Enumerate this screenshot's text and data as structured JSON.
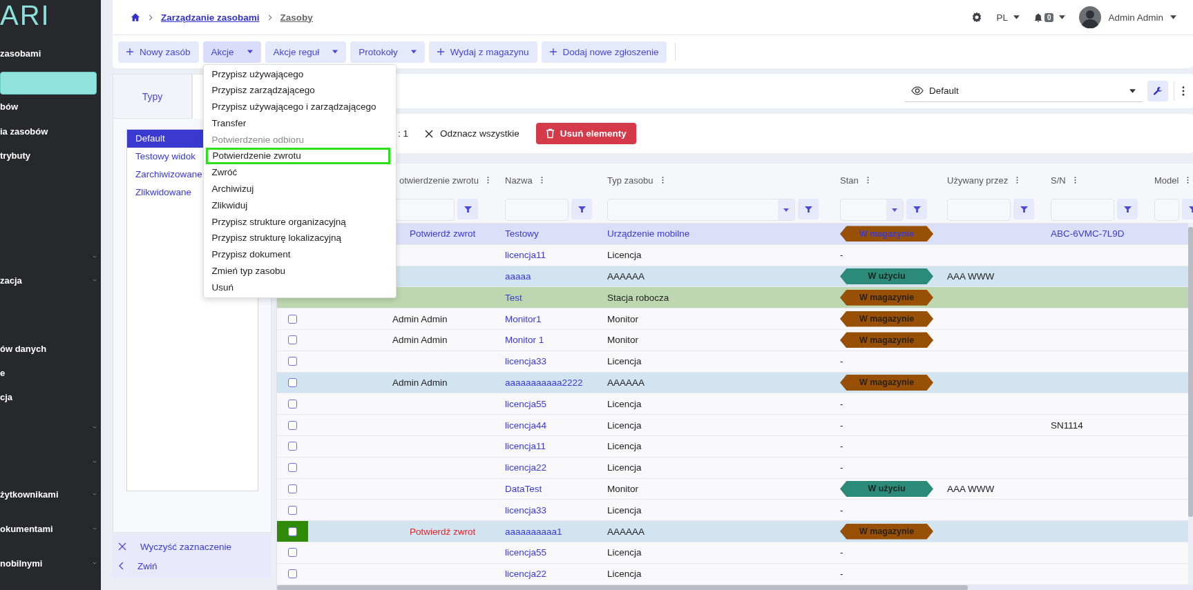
{
  "sidebar": {
    "logo": "ARI",
    "items": [
      {
        "label": "zasobami",
        "selected": false,
        "expandable": false
      },
      {
        "selected": true,
        "expandable": false
      },
      {
        "label": "bów",
        "selected": false,
        "expandable": false
      },
      {
        "label": "ia zasobów",
        "selected": false,
        "expandable": false
      },
      {
        "label": "trybuty",
        "selected": false,
        "expandable": false
      },
      {
        "selected": false,
        "expandable": true
      },
      {
        "label": "zacja",
        "selected": false,
        "expandable": true
      },
      {
        "label": "ów danych",
        "selected": false,
        "expandable": false
      },
      {
        "label": "e",
        "selected": false,
        "expandable": false
      },
      {
        "label": "cja",
        "selected": false,
        "expandable": false
      },
      {
        "selected": false,
        "expandable": true
      },
      {
        "selected": false,
        "expandable": true
      },
      {
        "label": "żytkownikami",
        "selected": false,
        "expandable": true
      },
      {
        "label": "okumentami",
        "selected": false,
        "expandable": true
      },
      {
        "label": "nobilnymi",
        "selected": false,
        "expandable": true
      }
    ]
  },
  "header": {
    "breadcrumb": [
      {
        "label": "Zarządzanie zasobami",
        "current": false
      },
      {
        "label": "Zasoby",
        "current": true
      }
    ],
    "language": "PL",
    "notifications": "0",
    "user": "Admin Admin"
  },
  "toolbar": {
    "buttons": [
      {
        "label": "Nowy zasób",
        "kind": "add",
        "expanded": false
      },
      {
        "label": "Akcje",
        "kind": "dropdown",
        "expanded": true
      },
      {
        "label": "Akcje reguł",
        "kind": "dropdown",
        "expanded": false
      },
      {
        "label": "Protokoły",
        "kind": "dropdown",
        "expanded": false
      },
      {
        "label": "Wydaj z magazynu",
        "kind": "add",
        "expanded": false
      },
      {
        "label": "Dodaj nowe zgłoszenie",
        "kind": "add",
        "expanded": false
      }
    ]
  },
  "actions_menu": {
    "items": [
      {
        "label": "Przypisz używającego",
        "disabled": false,
        "focused": false
      },
      {
        "label": "Przypisz zarządzającego",
        "disabled": false,
        "focused": false
      },
      {
        "label": "Przypisz używającego i zarządzającego",
        "disabled": false,
        "focused": false
      },
      {
        "label": "Transfer",
        "disabled": false,
        "focused": false
      },
      {
        "label": "Potwierdzenie odbioru",
        "disabled": true,
        "focused": false
      },
      {
        "label": "Potwierdzenie zwrotu",
        "disabled": false,
        "focused": true
      },
      {
        "label": "Zwróć",
        "disabled": false,
        "focused": false
      },
      {
        "label": "Archiwizuj",
        "disabled": false,
        "focused": false
      },
      {
        "label": "Zlikwiduj",
        "disabled": false,
        "focused": false
      },
      {
        "label": "Przypisz strukture organizacyjną",
        "disabled": false,
        "focused": false
      },
      {
        "label": "Przypisz strukturę lokalizacyjną",
        "disabled": false,
        "focused": false
      },
      {
        "label": "Przypisz dokument",
        "disabled": false,
        "focused": false
      },
      {
        "label": "Zmień typ zasobu",
        "disabled": false,
        "focused": false
      },
      {
        "label": "Usuń",
        "disabled": false,
        "focused": false
      }
    ]
  },
  "views_panel": {
    "tabs": [
      {
        "label": "Typy",
        "selected": false
      },
      {
        "selected": true
      }
    ],
    "views": [
      {
        "label": "Default",
        "selected": true
      },
      {
        "label": "Testowy widok",
        "selected": false
      },
      {
        "label": "Zarchiwizowane",
        "selected": false
      },
      {
        "label": "Zlikwidowane",
        "selected": false
      }
    ],
    "footer_actions": [
      {
        "label": "Wyczyść zaznaczenie",
        "kind": "clear"
      },
      {
        "label": "Zwiń",
        "kind": "collapse"
      }
    ]
  },
  "view_selector": {
    "value": "Default"
  },
  "selection_bar": {
    "count_text": ": 1",
    "clear_label": "Odznacz wszystkie",
    "delete_label": "Usuń elementy"
  },
  "table": {
    "columns": [
      {
        "label": "otwierdzenie zwrotu",
        "kind": "text"
      },
      {
        "label": "Nazwa",
        "kind": "text"
      },
      {
        "label": "Typ zasobu",
        "kind": "select"
      },
      {
        "label": "Stan",
        "kind": "select"
      },
      {
        "label": "Używany przez",
        "kind": "text"
      },
      {
        "label": "S/N",
        "kind": "text"
      },
      {
        "label": "Model",
        "kind": "text"
      }
    ],
    "rows": [
      {
        "selected": true,
        "return_action": {
          "label": "Potwierdź zwrot",
          "urgent": false
        },
        "name": "Testowy",
        "type": "Urządzenie mobilne",
        "status": {
          "label": "W magazynie",
          "kind": "in_stock"
        },
        "serial": "ABC-6VMC-7L9D"
      },
      {
        "selected": false,
        "name": "licencja11",
        "type": "Licencja",
        "status": {
          "label": "-",
          "kind": "none"
        }
      },
      {
        "selected": false,
        "color": "#d1e4ef",
        "name": "aaaaa",
        "type": "AAAAAA",
        "status": {
          "label": "W użyciu",
          "kind": "in_use"
        },
        "used_by": "AAA WWW"
      },
      {
        "selected": false,
        "color": "#bdd8b0",
        "name": "Test",
        "type": "Stacja robocza",
        "status": {
          "label": "W magazynie",
          "kind": "in_stock"
        }
      },
      {
        "selected": false,
        "checked": false,
        "flagged": false,
        "person": "Admin Admin",
        "name": "Monitor1",
        "type": "Monitor",
        "status": {
          "label": "W magazynie",
          "kind": "in_stock"
        }
      },
      {
        "selected": false,
        "checked": false,
        "flagged": false,
        "person": "Admin Admin",
        "name": "Monitor 1",
        "type": "Monitor",
        "status": {
          "label": "W magazynie",
          "kind": "in_stock"
        }
      },
      {
        "selected": false,
        "checked": false,
        "flagged": false,
        "name": "licencja33",
        "type": "Licencja",
        "status": {
          "label": "-",
          "kind": "none"
        }
      },
      {
        "selected": false,
        "checked": false,
        "flagged": false,
        "color": "#d1e4ef",
        "person": "Admin Admin",
        "name": "aaaaaaaaaaa2222",
        "type": "AAAAAA",
        "status": {
          "label": "W magazynie",
          "kind": "in_stock"
        }
      },
      {
        "selected": false,
        "checked": false,
        "flagged": false,
        "name": "licencja55",
        "type": "Licencja",
        "status": {
          "label": "-",
          "kind": "none"
        }
      },
      {
        "selected": false,
        "checked": false,
        "flagged": false,
        "name": "licencja44",
        "type": "Licencja",
        "status": {
          "label": "-",
          "kind": "none"
        },
        "serial": "SN1114"
      },
      {
        "selected": false,
        "checked": false,
        "flagged": false,
        "name": "licencja11",
        "type": "Licencja",
        "status": {
          "label": "-",
          "kind": "none"
        }
      },
      {
        "selected": false,
        "checked": false,
        "flagged": false,
        "name": "licencja22",
        "type": "Licencja",
        "status": {
          "label": "-",
          "kind": "none"
        }
      },
      {
        "selected": false,
        "checked": false,
        "flagged": false,
        "name": "DataTest",
        "type": "Monitor",
        "status": {
          "label": "W użyciu",
          "kind": "in_use"
        },
        "used_by": "AAA WWW"
      },
      {
        "selected": false,
        "checked": false,
        "flagged": false,
        "name": "licencja33",
        "type": "Licencja",
        "status": {
          "label": "-",
          "kind": "none"
        }
      },
      {
        "selected": false,
        "checked": false,
        "flagged": true,
        "color": "#d1e4ef",
        "return_action": {
          "label": "Potwierdź zwrot",
          "urgent": true
        },
        "name": "aaaaaaaaaa1",
        "type": "AAAAAA",
        "status": {
          "label": "W magazynie",
          "kind": "in_stock"
        }
      },
      {
        "selected": false,
        "checked": false,
        "flagged": false,
        "name": "licencja55",
        "type": "Licencja",
        "status": {
          "label": "-",
          "kind": "none"
        }
      },
      {
        "selected": false,
        "checked": false,
        "flagged": false,
        "name": "licencja22",
        "type": "Licencja",
        "status": {
          "label": "-",
          "kind": "none"
        }
      }
    ]
  }
}
